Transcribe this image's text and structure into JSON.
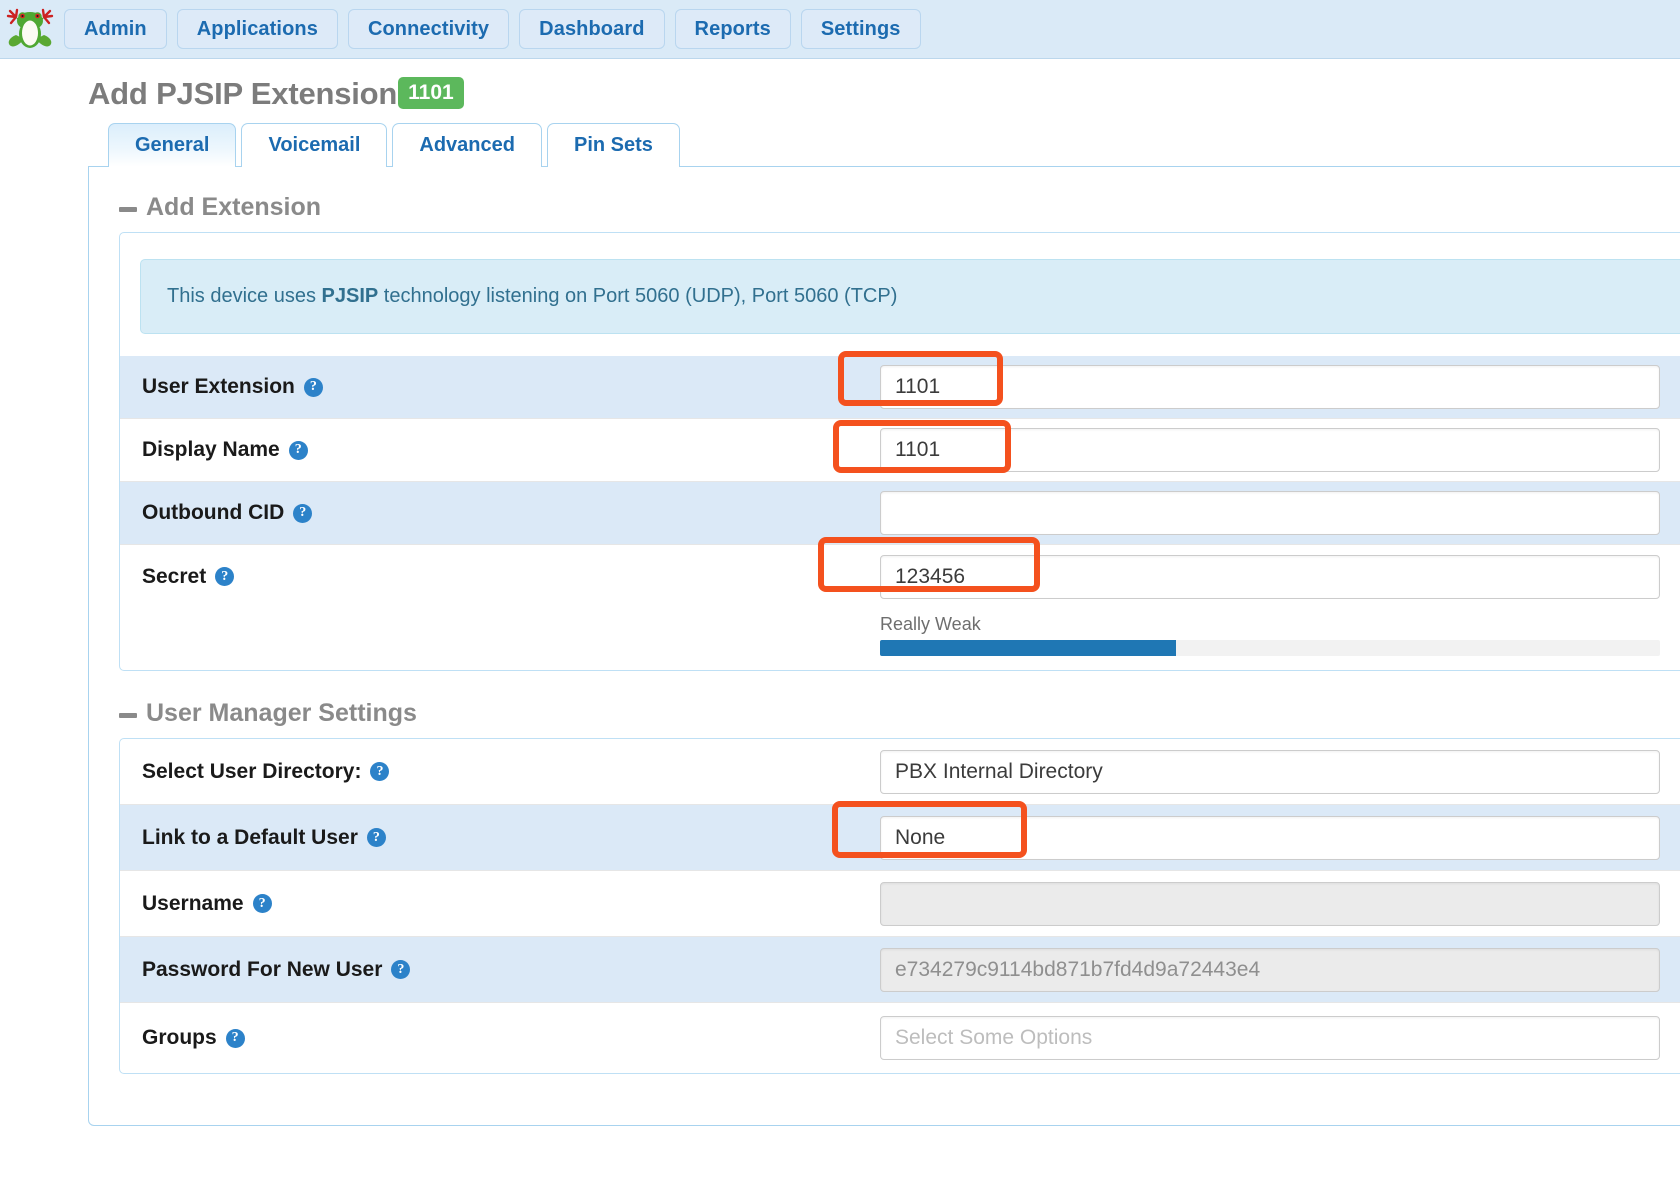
{
  "navbar": {
    "logo_icon": "freepbx-frog-logo",
    "items": [
      {
        "label": "Admin"
      },
      {
        "label": "Applications"
      },
      {
        "label": "Connectivity"
      },
      {
        "label": "Dashboard"
      },
      {
        "label": "Reports"
      },
      {
        "label": "Settings"
      }
    ]
  },
  "page": {
    "title": "Add PJSIP Extension",
    "badge": "1101"
  },
  "tabs": [
    {
      "label": "General",
      "active": true
    },
    {
      "label": "Voicemail",
      "active": false
    },
    {
      "label": "Advanced",
      "active": false
    },
    {
      "label": "Pin Sets",
      "active": false
    }
  ],
  "sections": {
    "add_extension": {
      "heading": "Add Extension",
      "alert": {
        "prefix": "This device uses ",
        "tech": "PJSIP",
        "suffix": " technology listening on Port 5060 (UDP), Port 5060 (TCP)"
      },
      "fields": [
        {
          "label": "User Extension",
          "value": "1101",
          "placeholder": "",
          "disabled": false,
          "highlighted": true
        },
        {
          "label": "Display Name",
          "value": "1101",
          "placeholder": "",
          "disabled": false,
          "highlighted": true
        },
        {
          "label": "Outbound CID",
          "value": "",
          "placeholder": "",
          "disabled": false,
          "highlighted": false
        },
        {
          "label": "Secret",
          "value": "123456",
          "placeholder": "",
          "disabled": false,
          "highlighted": true
        }
      ],
      "password_strength": {
        "label": "Really Weak",
        "percent": 38,
        "color": "#1f77b4"
      }
    },
    "user_manager": {
      "heading": "User Manager Settings",
      "fields": [
        {
          "label": "Select User Directory:",
          "value": "PBX Internal Directory",
          "placeholder": "",
          "disabled": false,
          "highlighted": false
        },
        {
          "label": "Link to a Default User",
          "value": "None",
          "placeholder": "",
          "disabled": false,
          "highlighted": true
        },
        {
          "label": "Username",
          "value": "",
          "placeholder": "",
          "disabled": true,
          "highlighted": false
        },
        {
          "label": "Password For New User",
          "value": "e734279c9114bd871b7fd4d9a72443e4",
          "placeholder": "",
          "disabled": true,
          "highlighted": false
        },
        {
          "label": "Groups",
          "value": "",
          "placeholder": "Select Some Options",
          "disabled": false,
          "highlighted": false
        }
      ]
    }
  },
  "colors": {
    "accent_blue": "#1c6bb0",
    "badge_green": "#5cb85c",
    "annotation_red": "#f4511e",
    "row_zebra": "#dbe9f7",
    "alert_bg": "#d9edf7"
  },
  "help_glyph": "?"
}
